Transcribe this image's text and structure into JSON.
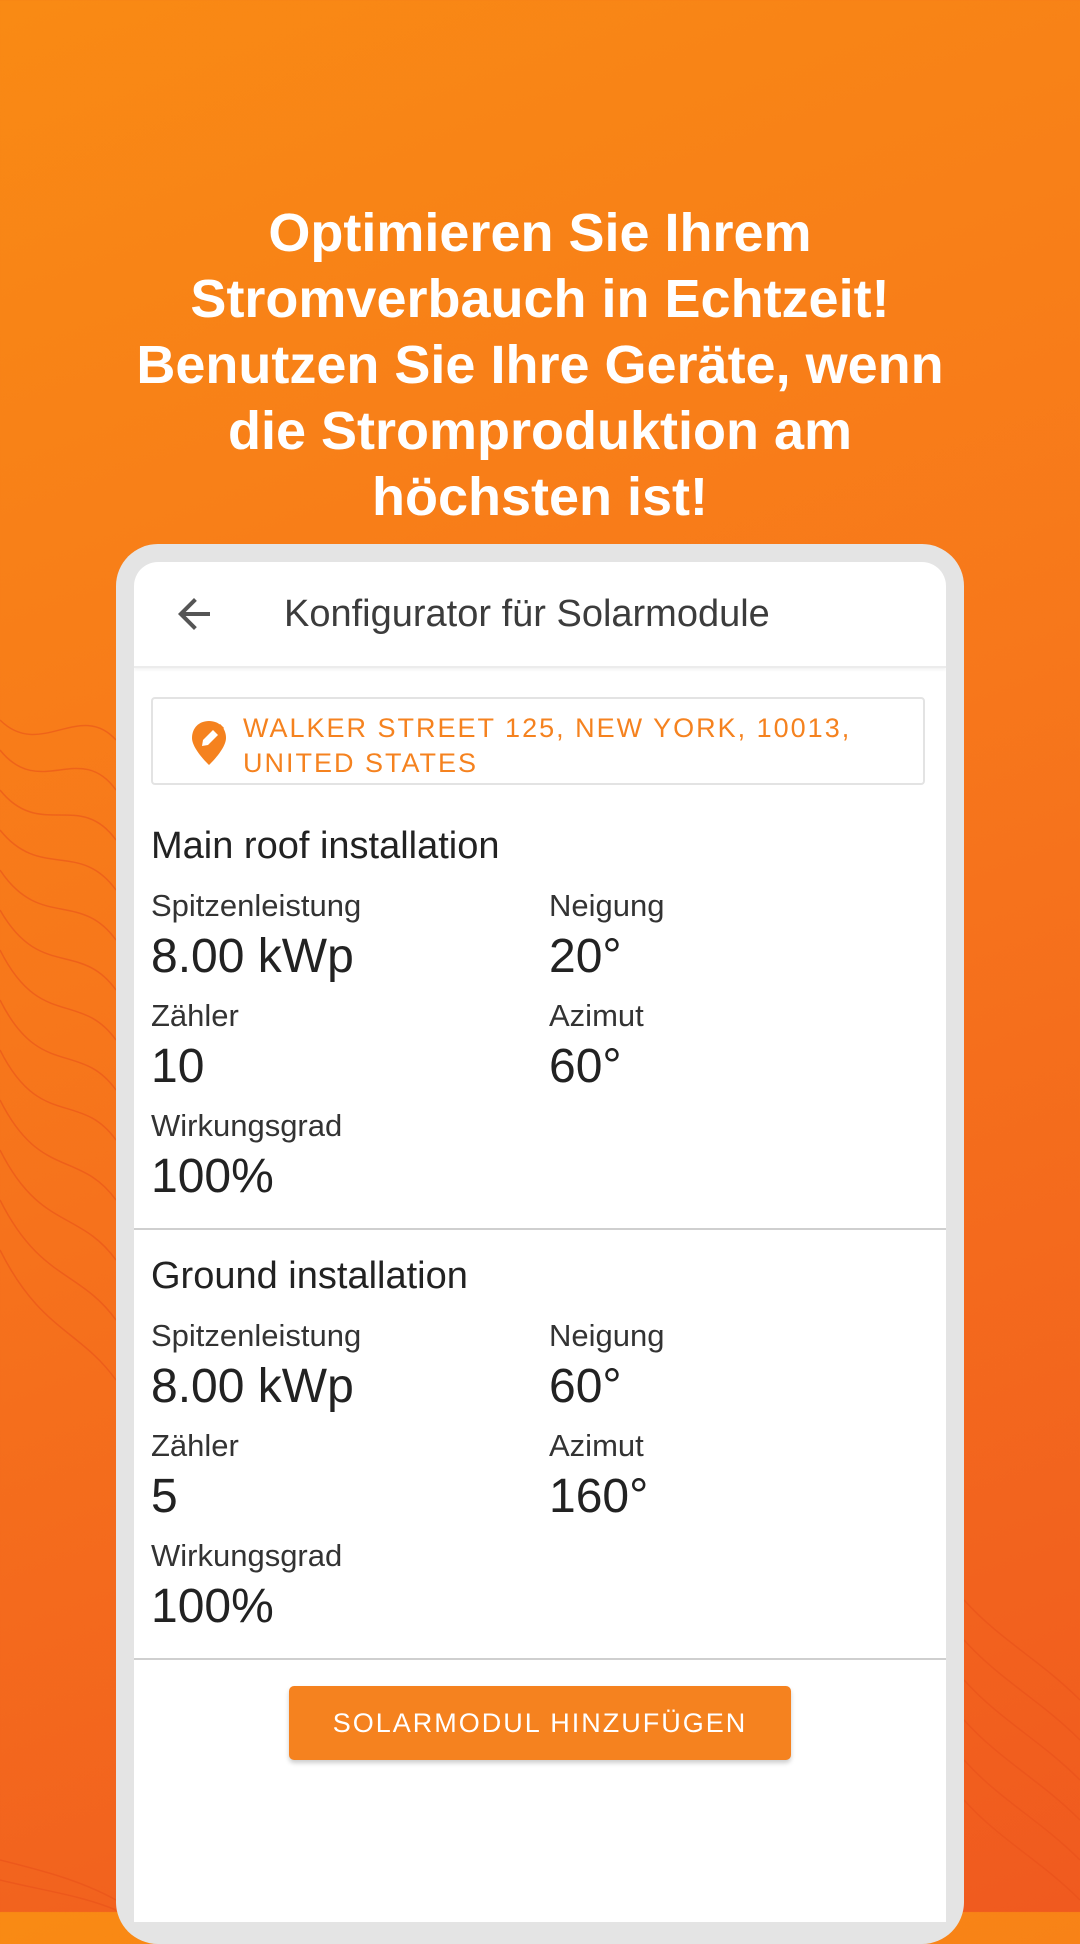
{
  "headline": "Optimieren Sie Ihrem\nStromverbauch in Echtzeit!\nBenutzen Sie Ihre Geräte, wenn\ndie Stromproduktion am\nhöchsten ist!",
  "appbar": {
    "title": "Konfigurator für Solarmodule",
    "back_icon": "arrow-back-icon"
  },
  "address": {
    "text": "WALKER STREET 125, NEW YORK, 10013, UNITED STATES",
    "icon": "location-edit-icon"
  },
  "installations": [
    {
      "title": "Main roof installation",
      "peak_label": "Spitzenleistung",
      "peak_value": "8.00 kWp",
      "tilt_label": "Neigung",
      "tilt_value": "20°",
      "count_label": "Zähler",
      "count_value": "10",
      "azimuth_label": "Azimut",
      "azimuth_value": "60°",
      "efficiency_label": "Wirkungsgrad",
      "efficiency_value": "100%"
    },
    {
      "title": "Ground installation",
      "peak_label": "Spitzenleistung",
      "peak_value": "8.00 kWp",
      "tilt_label": "Neigung",
      "tilt_value": "60°",
      "count_label": "Zähler",
      "count_value": "5",
      "azimuth_label": "Azimut",
      "azimuth_value": "160°",
      "efficiency_label": "Wirkungsgrad",
      "efficiency_value": "100%"
    }
  ],
  "add_button": {
    "label": "SOLARMODUL HINZUFÜGEN"
  },
  "colors": {
    "accent": "#f5821f",
    "background_start": "#f98a14",
    "background_end": "#f05a1f"
  }
}
